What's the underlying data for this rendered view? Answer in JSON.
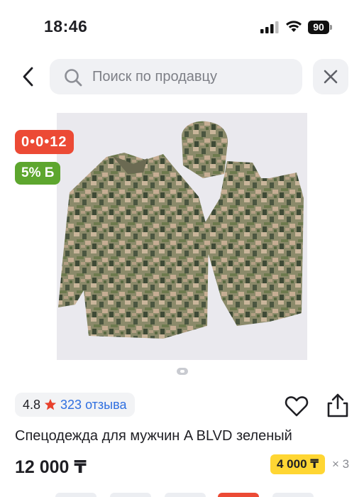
{
  "status_bar": {
    "time": "18:46",
    "battery": "90",
    "icons": [
      "signal-icon",
      "wifi-icon",
      "battery-icon"
    ]
  },
  "header": {
    "back_icon": "chevron-left-icon",
    "search_placeholder": "Поиск по продавцу",
    "search_value": "",
    "close_icon": "close-icon"
  },
  "product": {
    "promo_badge": "0•0•12",
    "cashback_badge": "5% Б",
    "rating": "4.8",
    "reviews": "323 отзыва",
    "title": "Спецодежда для мужчин A BLVD зеленый",
    "price": "12 000 ₸",
    "installment_price": "4 000 ₸",
    "installment_multiplier": "× 3",
    "image_count_indicator": 1
  },
  "colors": {
    "promo_red": "#ec4a35",
    "cashback_green": "#5da62e",
    "link_blue": "#2f6fe0",
    "star_red": "#e8412c",
    "installment_yellow": "#ffd633"
  }
}
